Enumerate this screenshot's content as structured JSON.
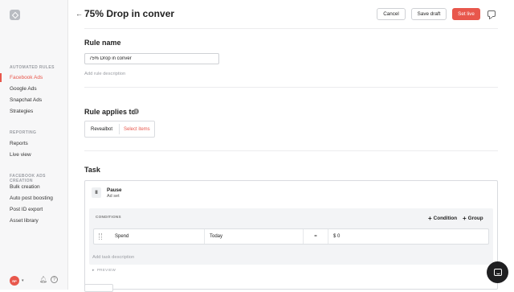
{
  "sidebar": {
    "sections": [
      {
        "title": "AUTOMATED RULES",
        "items": [
          "Facebook Ads",
          "Google Ads",
          "Snapchat Ads",
          "Strategies"
        ]
      },
      {
        "title": "REPORTING",
        "items": [
          "Reports",
          "Live view"
        ]
      },
      {
        "title": "FACEBOOK ADS CREATION",
        "items": [
          "Bulk creation",
          "Auto post boosting",
          "Post ID export",
          "Asset library"
        ]
      }
    ],
    "active_item": "Facebook Ads",
    "user_initials": "RP"
  },
  "header": {
    "title": "75% Drop in conver",
    "cancel_label": "Cancel",
    "save_draft_label": "Save draft",
    "set_live_label": "Set live"
  },
  "rule_name": {
    "heading": "Rule name",
    "value": "75% Drop in conver",
    "description_placeholder": "Add rule description"
  },
  "applies": {
    "heading": "Rule applies to",
    "account": "Revealbot",
    "select_label": "Select items"
  },
  "task": {
    "heading": "Task",
    "action_title": "Pause",
    "action_sub": "Ad set",
    "conditions_title": "CONDITIONS",
    "add_condition": "Condition",
    "add_group": "Group",
    "condition": {
      "metric": "Spend",
      "period": "Today",
      "operator": "=",
      "value": "$ 0"
    },
    "description_placeholder": "Add task description",
    "preview_label": "PREVIEW"
  },
  "colors": {
    "accent": "#e8574c",
    "sidebar_bg": "#f7f7f8"
  }
}
